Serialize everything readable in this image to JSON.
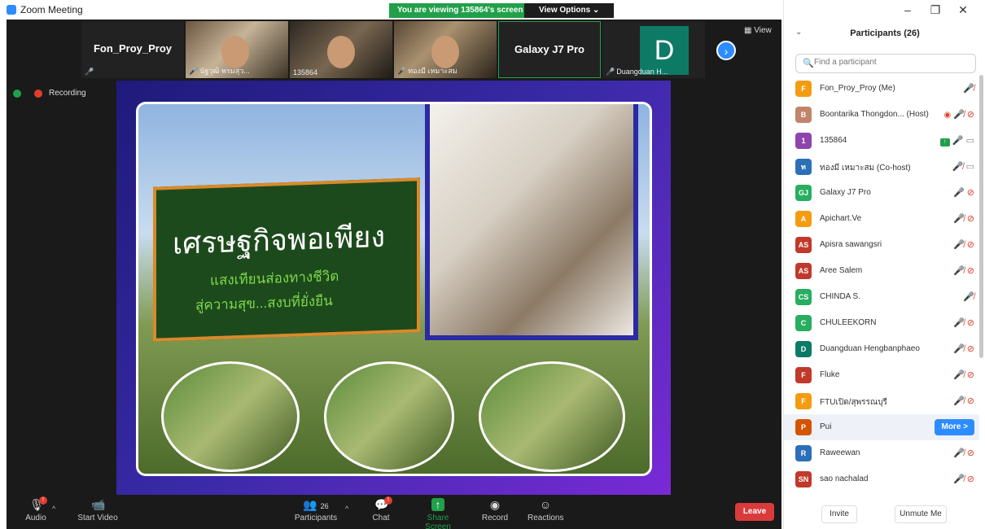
{
  "window": {
    "title": "Zoom Meeting",
    "viewing_banner": "You are viewing 135864's screen",
    "view_options": "View Options ⌄",
    "controls": {
      "minimize": "–",
      "restore": "❐",
      "close": "✕"
    }
  },
  "gallery": {
    "tiles": [
      {
        "label": "Fon_Proy_Proy",
        "caption": ""
      },
      {
        "label": "",
        "caption": "นัฐวุฒิ พรมสุว..."
      },
      {
        "label": "",
        "caption": "135864"
      },
      {
        "label": "",
        "caption": "ทองมี เหมาะสม"
      },
      {
        "label": "Galaxy J7 Pro",
        "caption": ""
      },
      {
        "label": "D",
        "caption": "Duangduan H..."
      }
    ],
    "view_label": "View"
  },
  "recording": {
    "label": "Recording"
  },
  "slide": {
    "title": "เศรษฐกิจพอเพียง",
    "subtitle_line1": "แสงเทียนส่องทางชีวิต",
    "subtitle_line2": "สู่ความสุข...สงบที่ยั่งยืน"
  },
  "toolbar": {
    "audio": "Audio",
    "start_video": "Start Video",
    "participants": "Participants",
    "participants_count": "26",
    "chat": "Chat",
    "share_screen": "Share Screen",
    "record": "Record",
    "reactions": "Reactions",
    "leave": "Leave"
  },
  "panel": {
    "title": "Participants (26)",
    "search_placeholder": "Find a participant",
    "more_label": "More >",
    "invite": "Invite",
    "unmute_me": "Unmute Me",
    "participants": [
      {
        "initials": "F",
        "color": "#f39c12",
        "name": "Fon_Proy_Proy (Me)",
        "audio": "muted",
        "video": ""
      },
      {
        "initials": "B",
        "color": "#c0846a",
        "name": "Boontarika Thongdon... (Host)",
        "audio": "muted",
        "video": "off"
      },
      {
        "initials": "1",
        "color": "#8e44ad",
        "name": "135864",
        "audio": "on",
        "video": "on"
      },
      {
        "initials": "ท",
        "color": "#2c6fb7",
        "name": "ทองมี เหมาะสม (Co-host)",
        "audio": "muted",
        "video": "on"
      },
      {
        "initials": "GJ",
        "color": "#27ae60",
        "name": "Galaxy J7 Pro",
        "audio": "on",
        "video": "off"
      },
      {
        "initials": "A",
        "color": "#f39c12",
        "name": "Apichart.Ve",
        "audio": "muted",
        "video": "off"
      },
      {
        "initials": "AS",
        "color": "#c0392b",
        "name": "Apisra sawangsri",
        "audio": "muted",
        "video": "off"
      },
      {
        "initials": "AS",
        "color": "#c0392b",
        "name": "Aree Salem",
        "audio": "muted",
        "video": "off"
      },
      {
        "initials": "CS",
        "color": "#27ae60",
        "name": "CHINDA S.",
        "audio": "muted",
        "video": ""
      },
      {
        "initials": "C",
        "color": "#27ae60",
        "name": "CHULEEKORN",
        "audio": "muted",
        "video": "off"
      },
      {
        "initials": "D",
        "color": "#0d7a66",
        "name": "Duangduan Hengbanphaeo",
        "audio": "muted",
        "video": "off"
      },
      {
        "initials": "F",
        "color": "#c0392b",
        "name": "Fluke",
        "audio": "muted",
        "video": "off"
      },
      {
        "initials": "F",
        "color": "#f39c12",
        "name": "FTUเปิด/สุพรรณบุรี",
        "audio": "muted",
        "video": "off"
      },
      {
        "initials": "P",
        "color": "#d35400",
        "name": "Pui",
        "audio": "",
        "video": ""
      },
      {
        "initials": "R",
        "color": "#2c6fb7",
        "name": "Raweewan",
        "audio": "muted",
        "video": "off"
      },
      {
        "initials": "SN",
        "color": "#c0392b",
        "name": "sao nachalad",
        "audio": "muted",
        "video": "off"
      }
    ]
  }
}
